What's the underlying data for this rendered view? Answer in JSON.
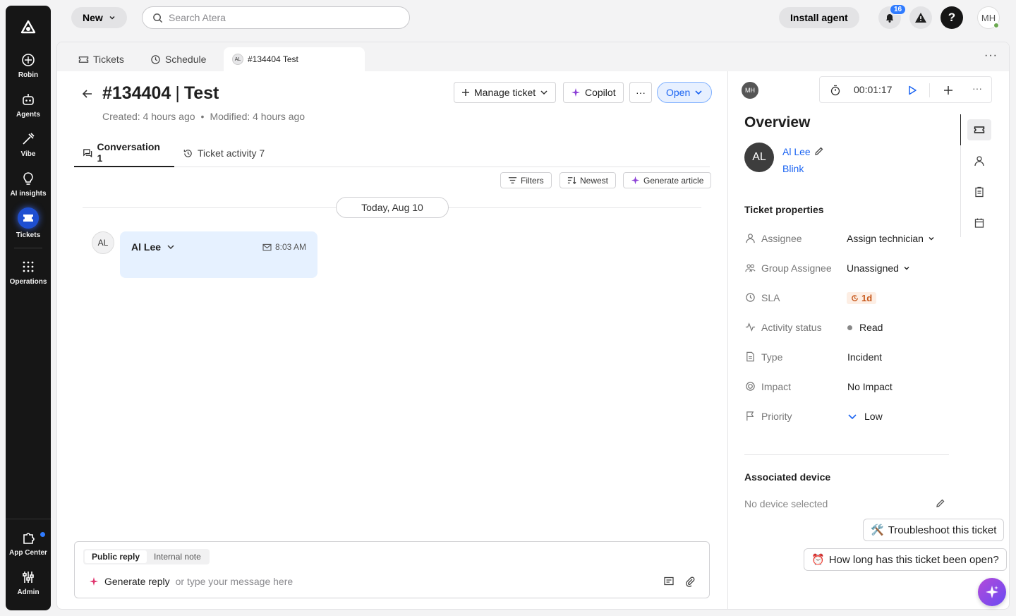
{
  "sidebar": {
    "items": [
      {
        "label": "Robin"
      },
      {
        "label": "Agents"
      },
      {
        "label": "Vibe"
      },
      {
        "label": "AI insights"
      },
      {
        "label": "Tickets"
      },
      {
        "label": "Operations"
      },
      {
        "label": "App Center"
      },
      {
        "label": "Admin"
      }
    ]
  },
  "topbar": {
    "new_label": "New",
    "search_placeholder": "Search Atera",
    "install_label": "Install agent",
    "notifications_count": "16",
    "help_label": "?",
    "user_initials": "MH"
  },
  "tabs": [
    {
      "label": "Tickets"
    },
    {
      "label": "Schedule"
    },
    {
      "label": "#134404 Test",
      "avatar": "AL"
    }
  ],
  "ticket": {
    "number": "#134404",
    "separator": "|",
    "name": "Test",
    "created": "Created: 4 hours ago",
    "modified": "Modified: 4 hours ago",
    "manage_label": "Manage ticket",
    "copilot_label": "Copilot",
    "more_label": "···",
    "status_label": "Open"
  },
  "conversation": {
    "tabs": [
      {
        "label": "Conversation 1"
      },
      {
        "label": "Ticket activity 7"
      }
    ],
    "filters_label": "Filters",
    "newest_label": "Newest",
    "generate_article_label": "Generate article",
    "date_label": "Today, Aug 10",
    "message": {
      "avatar": "AL",
      "sender": "Al Lee",
      "time": "8:03 AM"
    },
    "composer": {
      "public_reply": "Public reply",
      "internal_note": "Internal note",
      "generate_reply": "Generate reply",
      "placeholder": "or type your message here"
    }
  },
  "right_panel": {
    "user_initials": "MH",
    "timer": "00:01:17",
    "overview_title": "Overview",
    "contact": {
      "initials": "AL",
      "name": "Al Lee",
      "company": "Blink"
    },
    "properties_title": "Ticket properties",
    "properties": [
      {
        "label": "Assignee",
        "value": "Assign technician"
      },
      {
        "label": "Group Assignee",
        "value": "Unassigned"
      },
      {
        "label": "SLA",
        "value": "1d"
      },
      {
        "label": "Activity status",
        "value": "Read"
      },
      {
        "label": "Type",
        "value": "Incident"
      },
      {
        "label": "Impact",
        "value": "No Impact"
      },
      {
        "label": "Priority",
        "value": "Low"
      }
    ],
    "device_title": "Associated device",
    "device_value": "No device selected"
  },
  "suggestions": [
    {
      "emoji": "🛠️",
      "text": "Troubleshoot this ticket"
    },
    {
      "emoji": "⏰",
      "text": "How long has this ticket been open?"
    }
  ],
  "colors": {
    "accent": "#1b64f2",
    "sidebar": "#161616",
    "sla": "#c7581b"
  }
}
